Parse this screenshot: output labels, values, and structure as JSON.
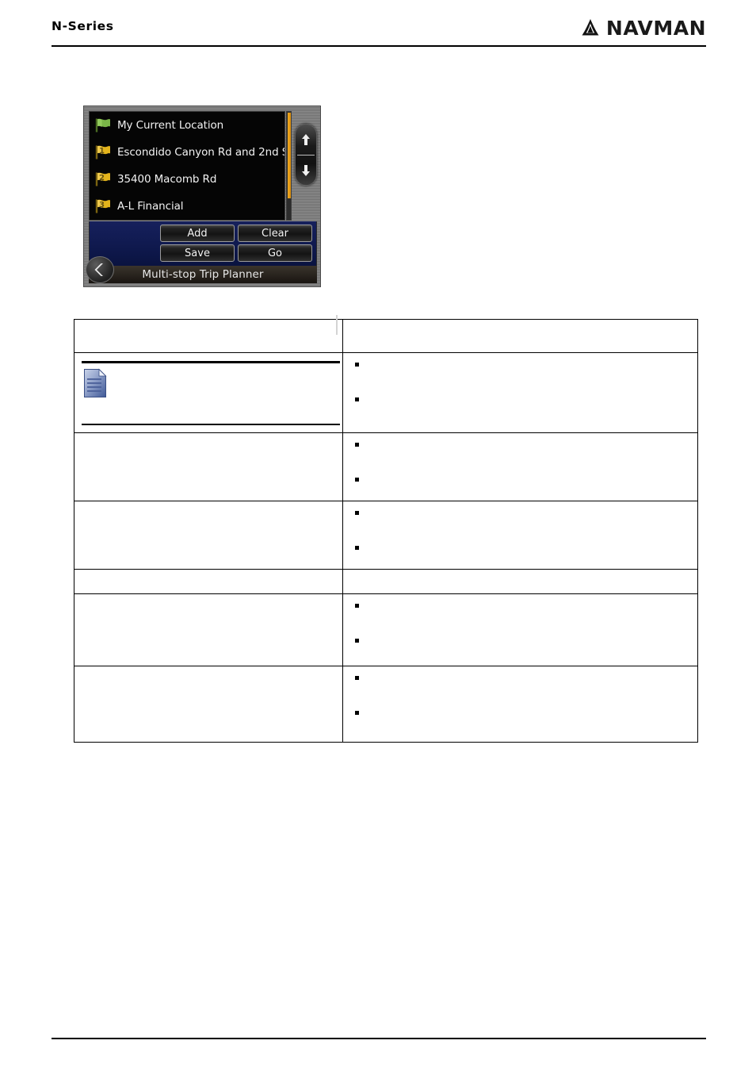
{
  "header": {
    "title": "N-Series",
    "brand": "NAVMAN",
    "brand_mark_icon": "navman-triangle-icon"
  },
  "device_screenshot": {
    "title_bar": "Multi-stop Trip Planner",
    "back_icon": "back-chevron-icon",
    "scroll_up_icon": "arrow-up-icon",
    "scroll_down_icon": "arrow-down-icon",
    "waypoints": [
      {
        "number": "",
        "label": "My Current Location",
        "flag_color": "#7ab648",
        "icon": "green-flag-icon"
      },
      {
        "number": "1",
        "label": "Escondido Canyon Rd and 2nd S",
        "flag_color": "#e3b41c",
        "icon": "yellow-flag-icon"
      },
      {
        "number": "2",
        "label": "35400 Macomb Rd",
        "flag_color": "#e3b41c",
        "icon": "yellow-flag-icon"
      },
      {
        "number": "3",
        "label": "A-L Financial",
        "flag_color": "#e3b41c",
        "icon": "yellow-flag-icon"
      }
    ],
    "buttons": [
      {
        "label": "Add"
      },
      {
        "label": "Clear"
      },
      {
        "label": "Save"
      },
      {
        "label": "Go"
      }
    ]
  },
  "content_table": {
    "header": {
      "col1": "",
      "col2": ""
    },
    "rows": [
      {
        "left_note": {
          "icon": "document-note-icon",
          "text": ""
        },
        "right_bullets": [
          "",
          ""
        ]
      },
      {
        "left": "",
        "right_bullets": [
          "",
          ""
        ]
      },
      {
        "left": "",
        "right_bullets": [
          "",
          ""
        ]
      },
      {
        "left": "",
        "right": ""
      },
      {
        "left": "",
        "right_bullets": [
          "",
          ""
        ]
      },
      {
        "left": "",
        "right_bullets": [
          "",
          ""
        ]
      }
    ]
  }
}
